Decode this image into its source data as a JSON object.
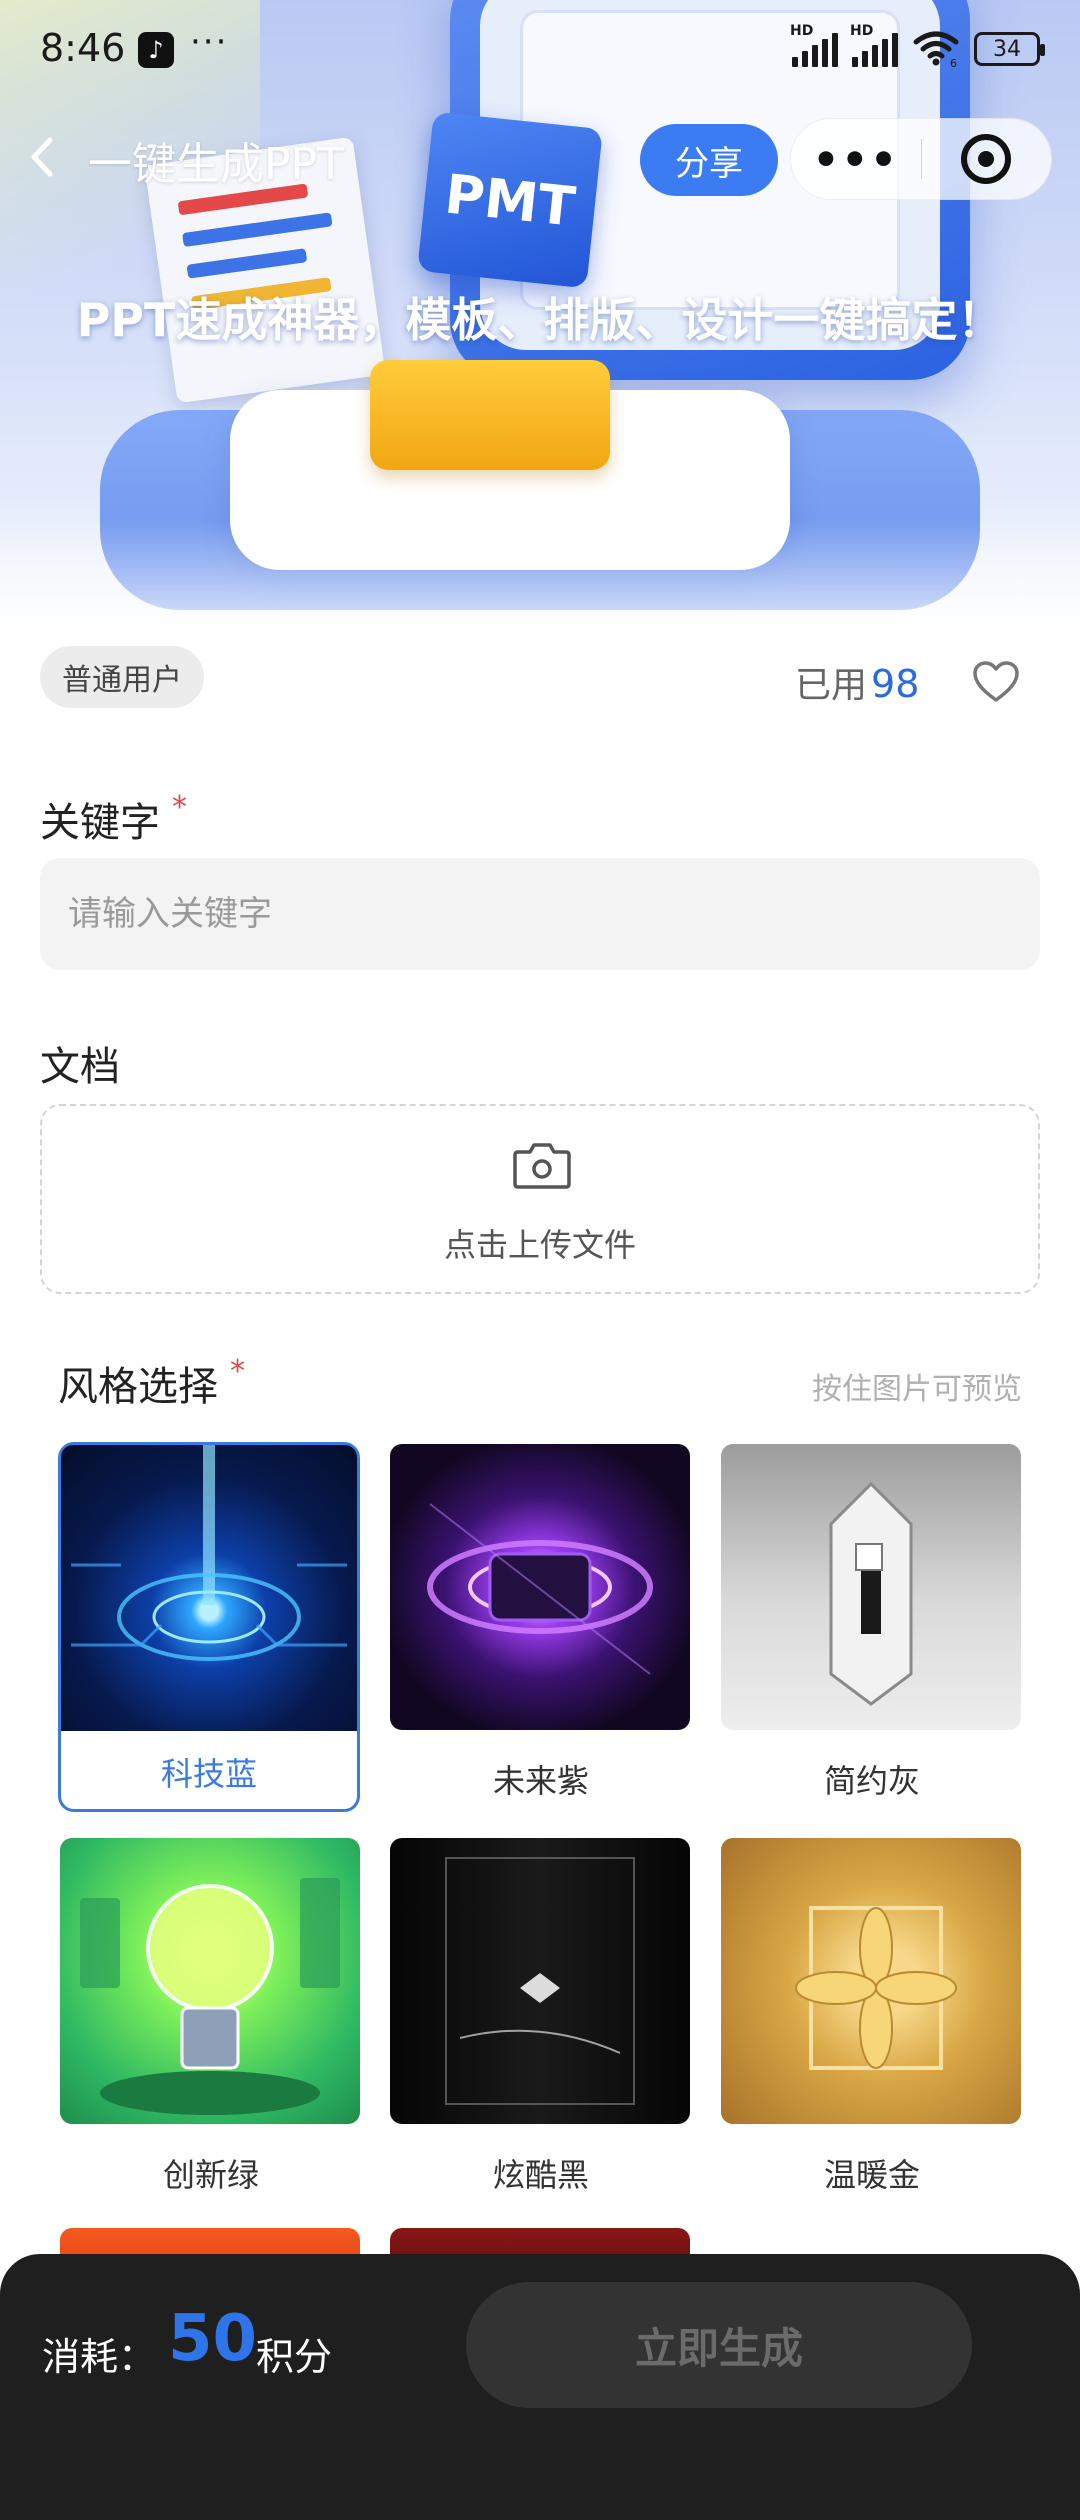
{
  "status_bar": {
    "time": "8:46",
    "app_icon": "tiktok-icon",
    "more": "···",
    "signal_1": "HD",
    "signal_2": "HD",
    "wifi": "6",
    "battery": "34"
  },
  "nav": {
    "back_icon": "chevron-left-icon",
    "title": "一键生成PPT",
    "share_label": "分享",
    "more_label": "•••",
    "target_icon": "target-icon"
  },
  "hero": {
    "slogan": "PPT速成神器，模板、排版、设计一键搞定！",
    "illustration_text": "PMT"
  },
  "user": {
    "badge": "普通用户",
    "used_label": "已用",
    "used_count": "98",
    "favorite_icon": "heart-icon"
  },
  "form": {
    "keyword_label": "关键字",
    "required_mark": "*",
    "keyword_placeholder": "请输入关键字",
    "keyword_value": "",
    "document_label": "文档",
    "upload_icon": "camera-icon",
    "upload_text": "点击上传文件",
    "style_label": "风格选择",
    "preview_hint": "按住图片可预览"
  },
  "styles": [
    {
      "name": "科技蓝",
      "selected": true
    },
    {
      "name": "未来紫",
      "selected": false
    },
    {
      "name": "简约灰",
      "selected": false
    },
    {
      "name": "创新绿",
      "selected": false
    },
    {
      "name": "炫酷黑",
      "selected": false
    },
    {
      "name": "温暖金",
      "selected": false
    }
  ],
  "bottom": {
    "cost_label": "消耗：",
    "cost_value": "50",
    "cost_unit": "积分",
    "generate_label": "立即生成"
  },
  "colors": {
    "accent": "#3c7cf2",
    "selected_border": "#3b7ae0",
    "required": "#e04848",
    "bottom_bar": "#1f1f1f"
  }
}
